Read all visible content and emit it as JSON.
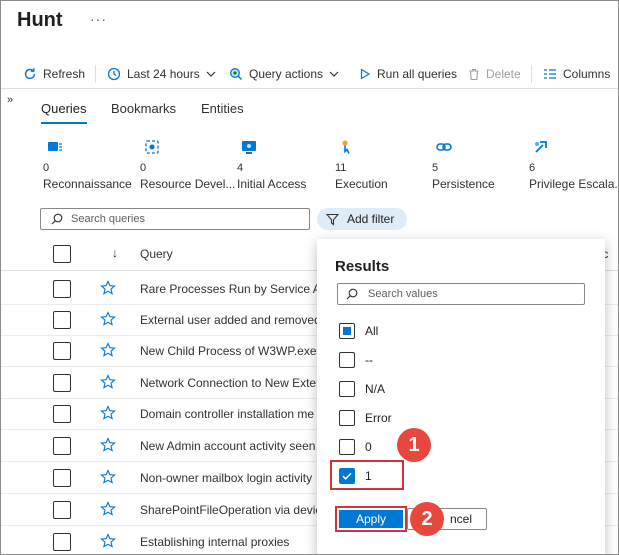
{
  "page": {
    "title": "Hunt",
    "more": "···"
  },
  "toolbar": {
    "refresh": "Refresh",
    "time_range": "Last 24 hours",
    "query_actions": "Query actions",
    "run_all": "Run all queries",
    "delete": "Delete",
    "columns": "Columns"
  },
  "tabs": [
    "Queries",
    "Bookmarks",
    "Entities"
  ],
  "tactics": [
    {
      "count": "0",
      "name": "Reconnaissance"
    },
    {
      "count": "0",
      "name": "Resource Devel..."
    },
    {
      "count": "4",
      "name": "Initial Access"
    },
    {
      "count": "11",
      "name": "Execution"
    },
    {
      "count": "5",
      "name": "Persistence"
    },
    {
      "count": "6",
      "name": "Privilege Escala..."
    }
  ],
  "search": {
    "placeholder": "Search queries"
  },
  "add_filter": "Add filter",
  "table": {
    "sort_arrow": "↓",
    "query_header": "Query",
    "right_header": "s c",
    "rows": [
      "Rare Processes Run by Service Acc",
      "External user added and removed",
      "New Child Process of W3WP.exe",
      "Network Connection to New Exter",
      "Domain controller installation me",
      "New Admin account activity seen",
      "Non-owner mailbox login activity",
      "SharePointFileOperation via devic",
      "Establishing internal proxies"
    ]
  },
  "filter_popup": {
    "title": "Results",
    "search_placeholder": "Search values",
    "options": [
      {
        "label": "All",
        "state": "partial"
      },
      {
        "label": "--",
        "state": "unchecked"
      },
      {
        "label": "N/A",
        "state": "unchecked"
      },
      {
        "label": "Error",
        "state": "unchecked"
      },
      {
        "label": "0",
        "state": "unchecked"
      },
      {
        "label": "1",
        "state": "checked"
      }
    ],
    "apply": "Apply",
    "cancel": "ncel"
  },
  "callouts": [
    "1",
    "2"
  ],
  "colors": {
    "accent": "#0078d4",
    "highlight": "#d13438",
    "callout": "#e8473e"
  }
}
